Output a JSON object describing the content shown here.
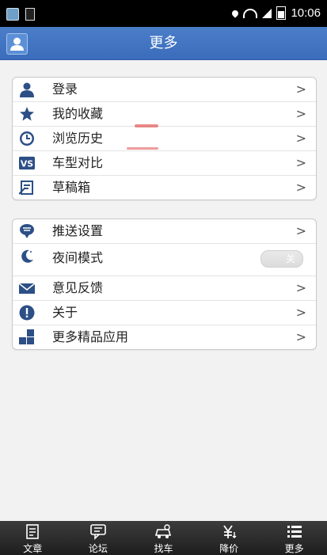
{
  "status_bar": {
    "time": "10:06"
  },
  "header": {
    "title": "更多"
  },
  "group1": [
    {
      "label": "登录",
      "icon": "user-icon"
    },
    {
      "label": "我的收藏",
      "icon": "star-icon"
    },
    {
      "label": "浏览历史",
      "icon": "clock-icon"
    },
    {
      "label": "车型对比",
      "icon": "vs-icon"
    },
    {
      "label": "草稿箱",
      "icon": "draft-icon"
    }
  ],
  "group2": [
    {
      "label": "推送设置",
      "icon": "push-icon"
    },
    {
      "label": "夜间模式",
      "icon": "night-mode-icon",
      "toggle": "关"
    },
    {
      "label": "意见反馈",
      "icon": "mail-icon"
    },
    {
      "label": "关于",
      "icon": "info-icon"
    },
    {
      "label": "更多精品应用",
      "icon": "apps-icon"
    }
  ],
  "chevron": ">",
  "bottom_nav": [
    {
      "label": "文章",
      "icon": "article-icon"
    },
    {
      "label": "论坛",
      "icon": "forum-icon"
    },
    {
      "label": "找车",
      "icon": "car-icon"
    },
    {
      "label": "降价",
      "icon": "price-drop-icon"
    },
    {
      "label": "更多",
      "icon": "more-list-icon"
    }
  ],
  "colors": {
    "header": "#3a6cbb",
    "icon": "#2c4f86",
    "background": "#f2f2f2",
    "bottom_nav": "#2a2a2a"
  }
}
